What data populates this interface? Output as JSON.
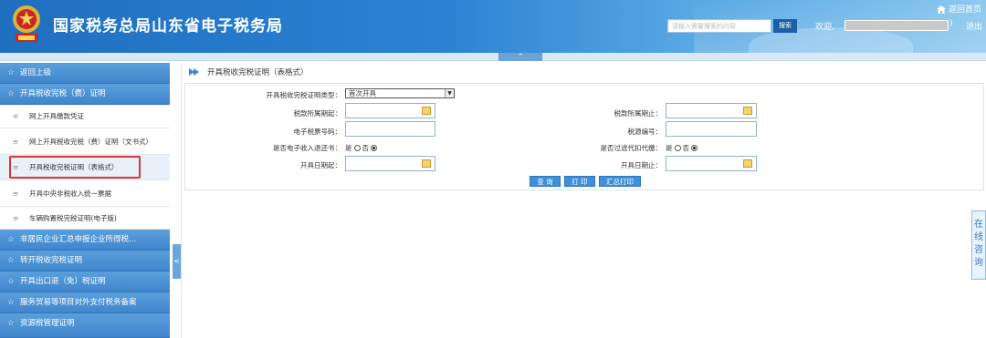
{
  "header": {
    "site_title": "国家税务总局山东省电子税务局",
    "search_placeholder": "请输入需要搜索的内容",
    "search_button": "搜索",
    "welcome": "欢迎,",
    "user_suffix": ")",
    "logout": "退出",
    "home": "返回首页",
    "collapse_symbol": "^",
    "brand_color": "#2b82d3"
  },
  "sidebar": {
    "items": [
      {
        "label": "返回上级",
        "type": "group"
      },
      {
        "label": "开具税收完税（费）证明",
        "type": "group"
      },
      {
        "label": "网上开具缴款凭证",
        "type": "sub"
      },
      {
        "label": "网上开具税收完税（费）证明（文书式）",
        "type": "sub"
      },
      {
        "label": "开具税收完税证明（表格式）",
        "type": "sub",
        "active": true
      },
      {
        "label": "开具中央非税收入统一票据",
        "type": "sub"
      },
      {
        "label": "车辆购置税完税证明(电子版)",
        "type": "sub"
      },
      {
        "label": "非居民企业汇总申报企业所得税...",
        "type": "group"
      },
      {
        "label": "转开税收完税证明",
        "type": "group"
      },
      {
        "label": "开具出口退（免）税证明",
        "type": "group"
      },
      {
        "label": "服务贸易等项目对外支付税务备案",
        "type": "group"
      },
      {
        "label": "资源税管理证明",
        "type": "group"
      }
    ],
    "star_symbol": "☆",
    "bullet_symbol": "≡",
    "handle_symbol": "<"
  },
  "main": {
    "breadcrumb": "开具税收完税证明（表格式）",
    "form": {
      "cert_type_label": "开具税收完税证明类型：",
      "cert_type_value": "首次开具",
      "tax_period_start_label": "税款所属期起：",
      "tax_period_end_label": "税款所属期止：",
      "e_ticket_no_label": "电子税票号码：",
      "tax_source_no_label": "税源编号：",
      "e_refund_label": "是否电子收入退还书：",
      "withholding_label": "是否过滤代扣代缴：",
      "issue_date_start_label": "开具日期起：",
      "issue_date_end_label": "开具日期止：",
      "yes_label": "是",
      "no_label": "否",
      "e_refund_selected": "否",
      "withholding_selected": "否"
    },
    "buttons": {
      "query": "查 询",
      "print": "打 印",
      "summary_print": "汇总打印"
    }
  },
  "float_tab": {
    "chars": [
      "在",
      "线",
      "咨",
      "询"
    ]
  }
}
